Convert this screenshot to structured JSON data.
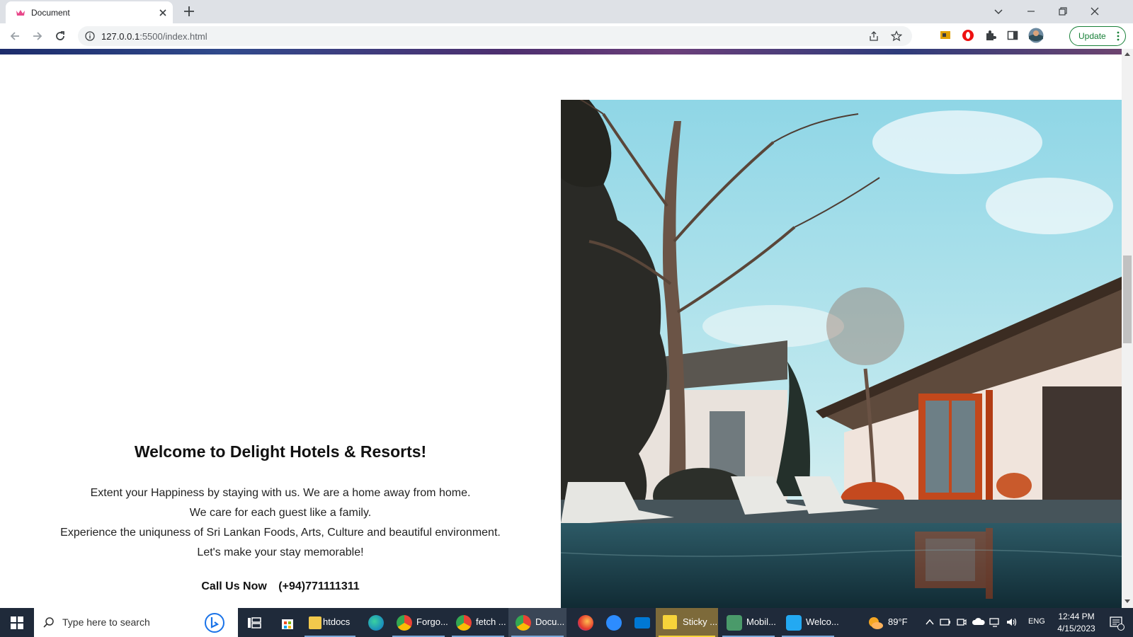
{
  "browser": {
    "tab_title": "Document",
    "url_host": "127.0.0.1",
    "url_path": ":5500/index.html",
    "update_label": "Update"
  },
  "page": {
    "welcome_title": "Welcome to Delight Hotels & Resorts!",
    "welcome_lines": [
      "Extent your Happiness by staying with us. We are a home away from home.",
      "We care for each guest like a family.",
      "Experience the uniquness of Sri Lankan Foods, Arts, Culture and beautiful environment.",
      "Let's make your stay memorable!"
    ],
    "call_label": "Call Us Now",
    "call_number": "(+94)771111311"
  },
  "taskbar": {
    "search_placeholder": "Type here to search",
    "apps": [
      {
        "name": "htdocs",
        "label": "htdocs",
        "icon": "folder-icon"
      },
      {
        "name": "forgo",
        "label": "Forgo...",
        "icon": "chrome-icon"
      },
      {
        "name": "fetch",
        "label": "fetch ...",
        "icon": "chrome-icon"
      },
      {
        "name": "docu",
        "label": "Docu...",
        "icon": "chrome-icon",
        "active": true
      },
      {
        "name": "sticky",
        "label": "Sticky ...",
        "icon": "sticky-notes-icon"
      },
      {
        "name": "mobil",
        "label": "Mobil...",
        "icon": "mobile-app-icon"
      },
      {
        "name": "welco",
        "label": "Welco...",
        "icon": "vscode-icon"
      }
    ],
    "weather_temp": "89°F",
    "language": "ENG",
    "time": "12:44 PM",
    "date": "4/15/2023"
  },
  "colors": {
    "tab_strip": "#dee1e6",
    "update_green": "#188038",
    "taskbar": "#1f2a3a"
  }
}
